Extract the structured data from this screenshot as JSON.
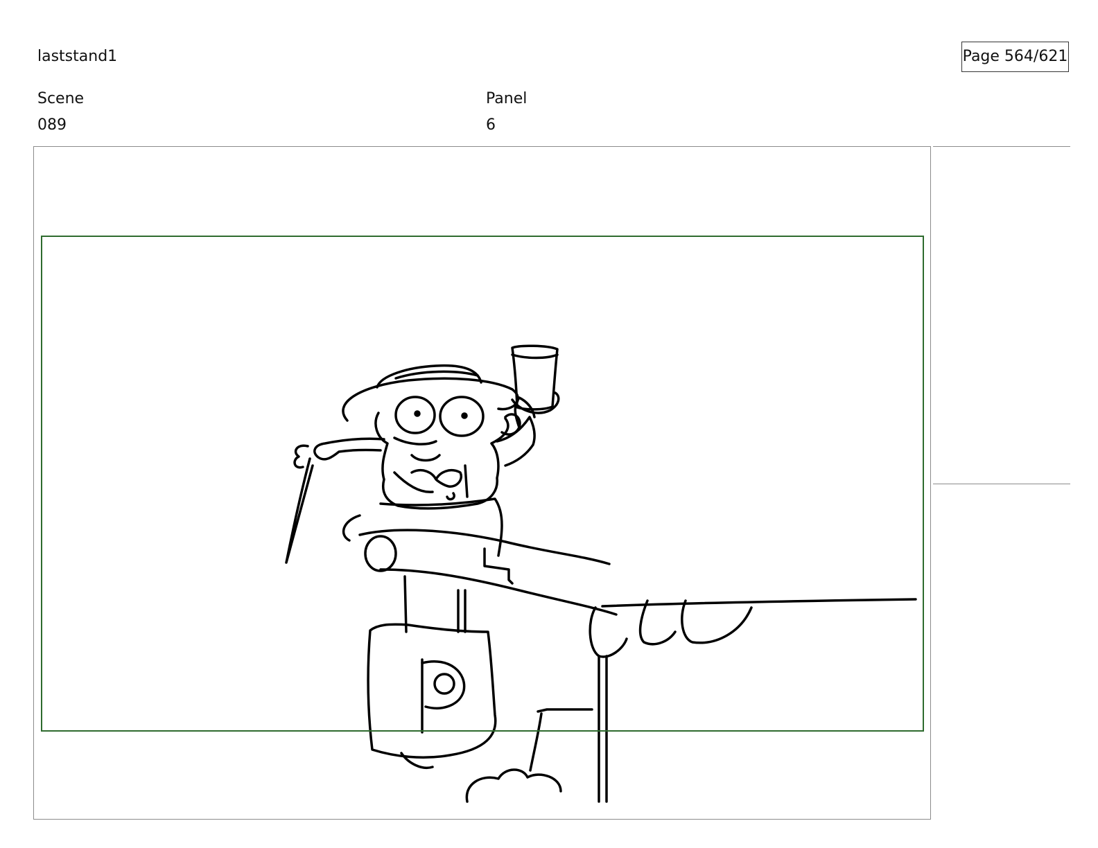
{
  "header": {
    "project_title": "laststand1",
    "page_counter": "Page 564/621"
  },
  "meta": {
    "scene_label": "Scene",
    "scene_value": "089",
    "panel_label": "Panel",
    "panel_value": "6"
  },
  "colors": {
    "safe_frame": "#2e6b2e",
    "panel_border": "#8a8a8a",
    "ink": "#000000"
  }
}
